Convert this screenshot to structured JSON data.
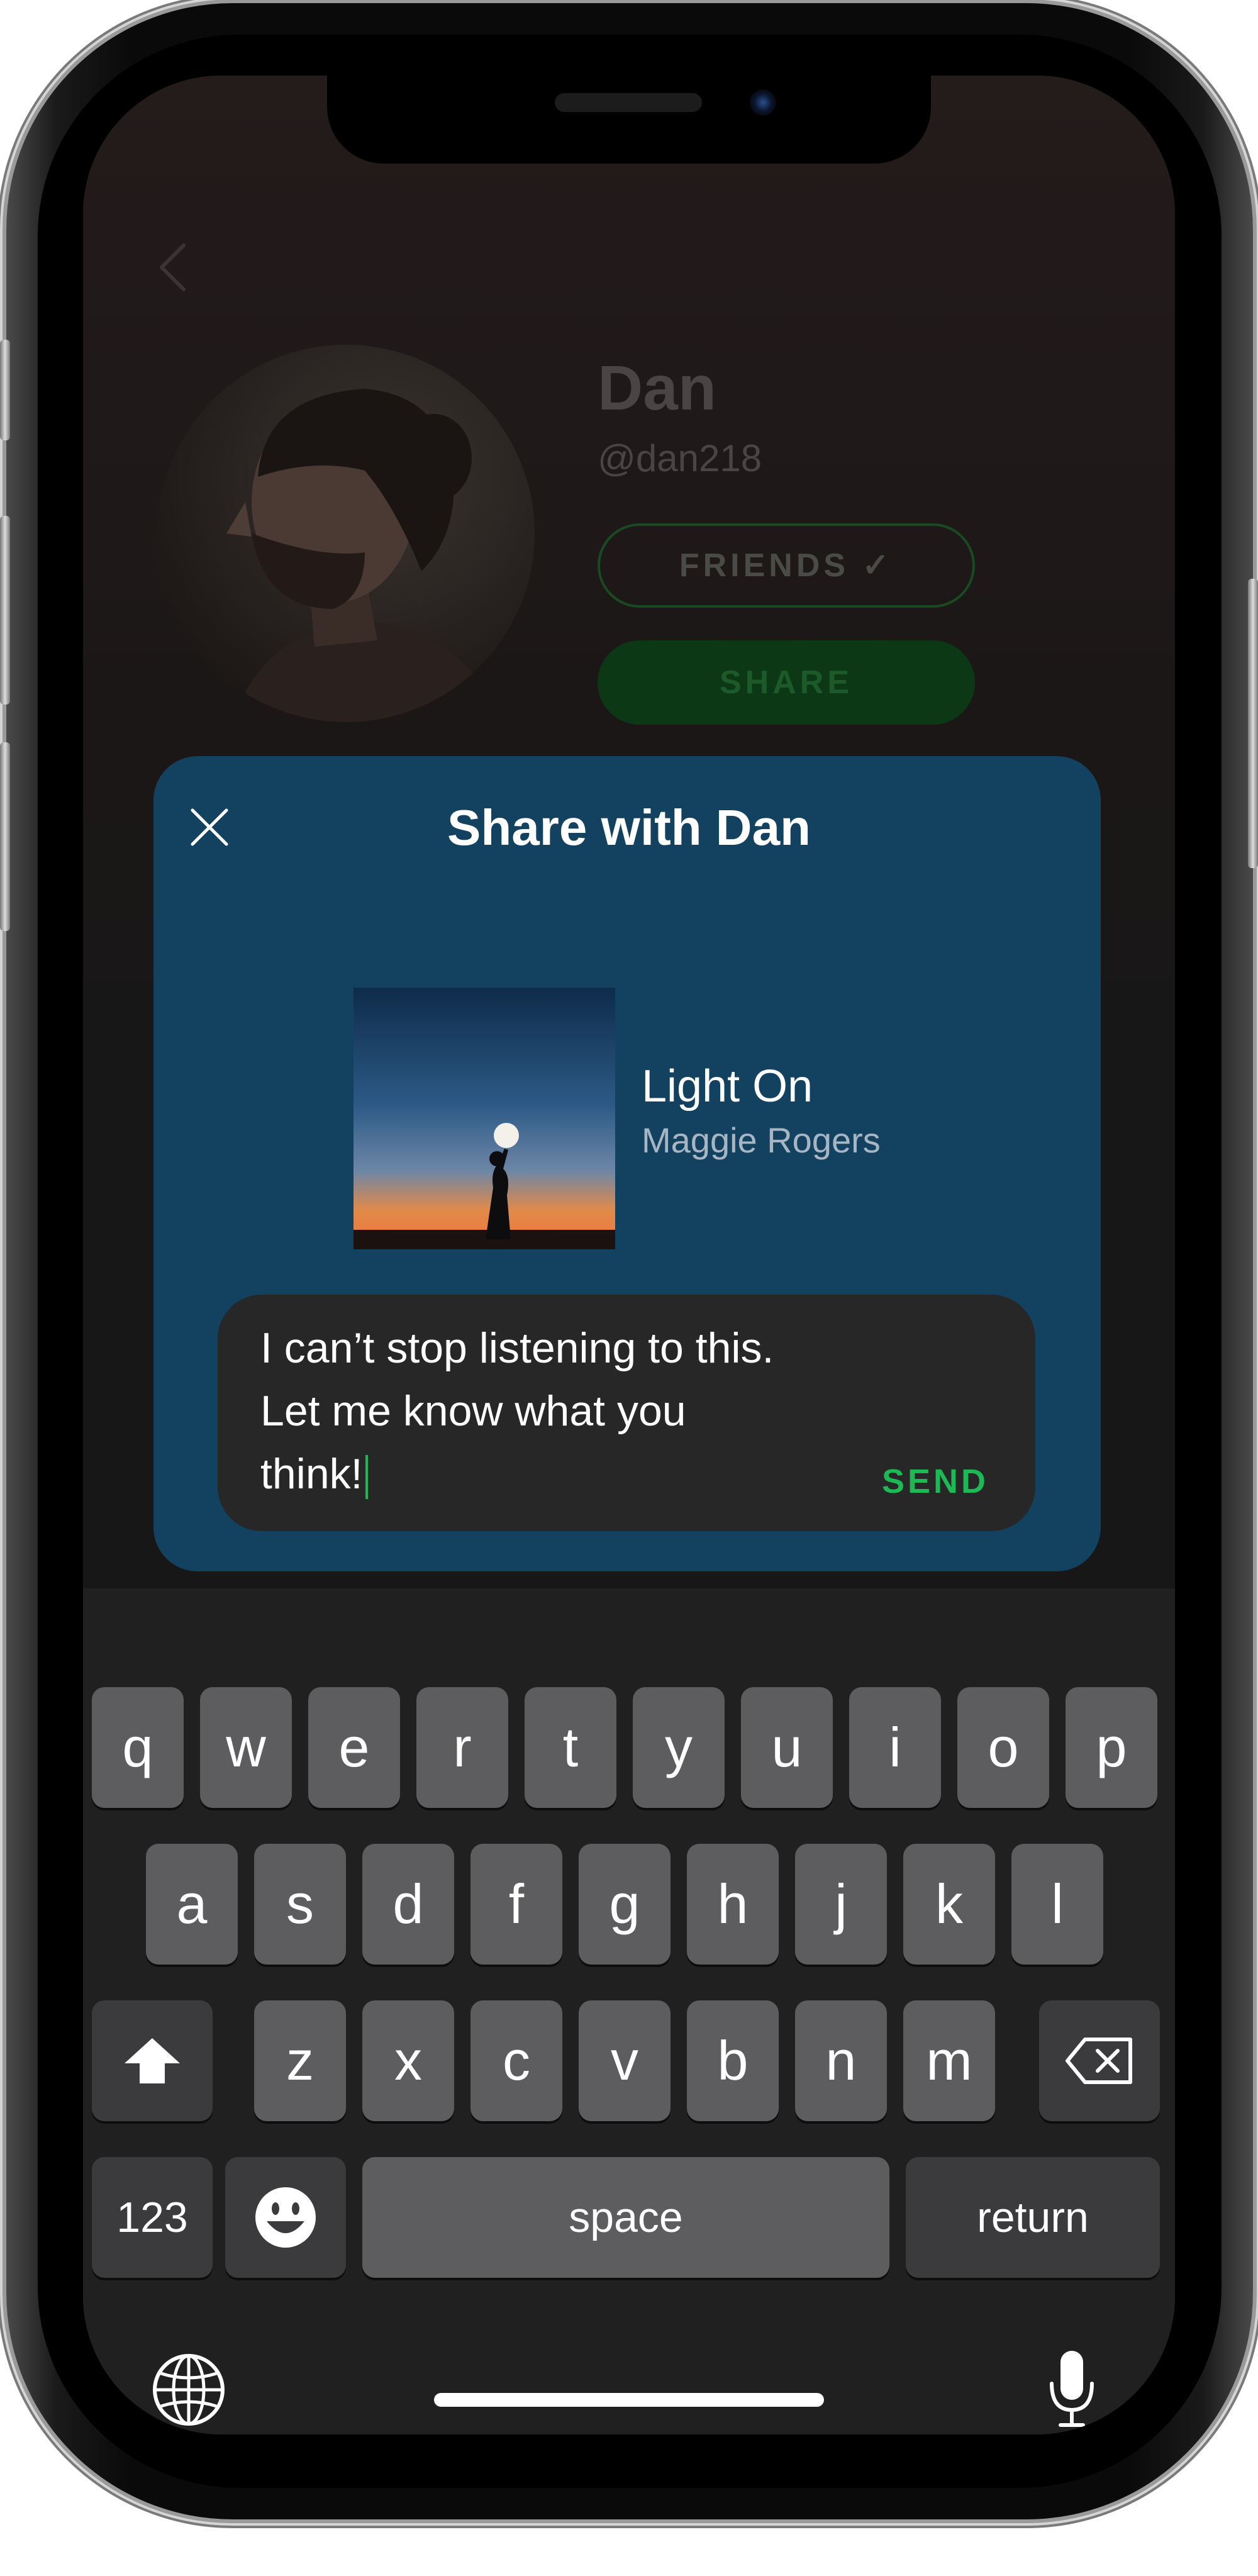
{
  "profile": {
    "name": "Dan",
    "handle": "@dan218",
    "friends_label": "FRIENDS ✓",
    "share_label": "SHARE"
  },
  "share_modal": {
    "title": "Share with Dan",
    "track": {
      "title": "Light On",
      "artist": "Maggie Rogers"
    },
    "message_lines": [
      "I can’t stop listening to this.",
      "Let me know what you",
      "think!"
    ],
    "send_label": "SEND"
  },
  "keyboard": {
    "row1": [
      "q",
      "w",
      "e",
      "r",
      "t",
      "y",
      "u",
      "i",
      "o",
      "p"
    ],
    "row2": [
      "a",
      "s",
      "d",
      "f",
      "g",
      "h",
      "j",
      "k",
      "l"
    ],
    "row3": [
      "z",
      "x",
      "c",
      "v",
      "b",
      "n",
      "m"
    ],
    "numbers_label": "123",
    "space_label": "space",
    "return_label": "return"
  },
  "colors": {
    "accent": "#1db954",
    "modal_bg": "#134260",
    "keyboard_bg": "#202020",
    "key_bg": "#5d5d5f"
  }
}
